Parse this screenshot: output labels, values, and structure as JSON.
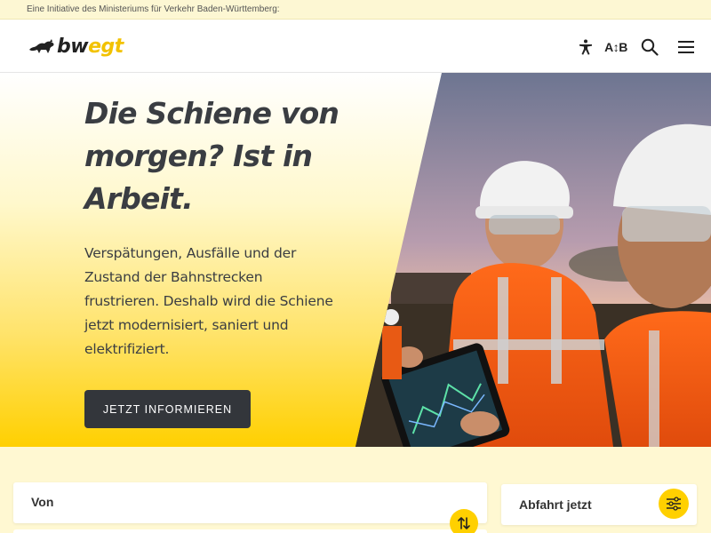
{
  "topbar": {
    "text": "Eine Initiative des Ministeriums für Verkehr Baden-Württemberg:"
  },
  "header": {
    "logo": {
      "text_main": "bw",
      "text_accent": "egt",
      "icon": "lion-icon"
    },
    "icons": [
      "accessibility-icon",
      "language-icon",
      "search-icon",
      "menu-icon"
    ],
    "language_label": "A↕B"
  },
  "hero": {
    "title": "Die Schiene von morgen? Ist in Arbeit.",
    "text": "Verspätungen, Ausfälle und der Zustand der Bahnstrecken frustrieren. Deshalb wird die Schiene jetzt modernisiert, saniert und elektrifiziert.",
    "cta_label": "JETZT INFORMIEREN",
    "image": "railway-workers-with-tablet-photo"
  },
  "search": {
    "from_label": "Von",
    "depart_label": "Abfahrt jetzt",
    "swap_icon": "swap-arrows-icon",
    "filter_icon": "filter-sliders-icon"
  },
  "colors": {
    "accent": "#ffd000",
    "dark": "#33363b",
    "topbar_bg": "#fdf7d3"
  }
}
